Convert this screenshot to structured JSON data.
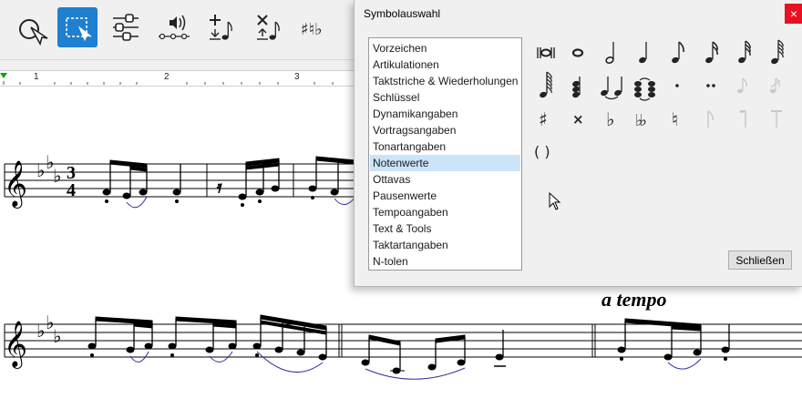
{
  "toolbar": {
    "buttons": [
      {
        "name": "select-tool",
        "icon": "pointer-circle-icon",
        "active": false
      },
      {
        "name": "rectangle-select-tool",
        "icon": "rectangle-select-icon",
        "active": true
      },
      {
        "name": "mixer-tool",
        "icon": "sliders-icon",
        "active": false
      },
      {
        "name": "playback-tool",
        "icon": "speaker-icon",
        "active": false
      },
      {
        "name": "insert-note-tool",
        "icon": "plus-note-icon",
        "active": false
      },
      {
        "name": "delete-note-tool",
        "icon": "cross-note-icon",
        "active": false
      },
      {
        "name": "accidentals-tool",
        "icon": "sharp-natural-flat-icon",
        "active": false
      }
    ],
    "accent_color": "#1f7fd1"
  },
  "ruler": {
    "numbers": [
      "1",
      "2",
      "3"
    ],
    "marker_color": "#00aa00"
  },
  "score": {
    "tempo_text": "a tempo"
  },
  "dialog": {
    "title": "Symbolauswahl",
    "close_glyph": "×",
    "categories": [
      "Vorzeichen",
      "Artikulationen",
      "Taktstriche & Wiederholungen",
      "Schlüssel",
      "Dynamikangaben",
      "Vortragsangaben",
      "Tonartangaben",
      "Notenwerte",
      "Ottavas",
      "Pausenwerte",
      "Tempoangaben",
      "Text & Tools",
      "Taktartangaben",
      "N-tolen"
    ],
    "selected_category": "Notenwerte",
    "symbols": [
      {
        "name": "double-whole-note-icon"
      },
      {
        "name": "whole-note-icon"
      },
      {
        "name": "half-note-icon"
      },
      {
        "name": "quarter-note-icon"
      },
      {
        "name": "eighth-note-icon"
      },
      {
        "name": "sixteenth-note-icon"
      },
      {
        "name": "thirty-second-note-icon"
      },
      {
        "name": "sixty-fourth-note-icon"
      },
      {
        "name": "hundred-twenty-eighth-note-icon"
      },
      {
        "name": "chord-icon"
      },
      {
        "name": "tie-icon"
      },
      {
        "name": "tied-chord-icon"
      },
      {
        "name": "dot-icon"
      },
      {
        "name": "double-dot-icon"
      },
      {
        "name": "grace-note-icon",
        "disabled": true
      },
      {
        "name": "grace-note-slashed-icon",
        "disabled": true
      },
      {
        "name": "sharp-icon",
        "glyph": "♯"
      },
      {
        "name": "double-sharp-icon",
        "glyph": "×"
      },
      {
        "name": "flat-icon",
        "glyph": "♭"
      },
      {
        "name": "double-flat-icon",
        "glyph": "♭♭"
      },
      {
        "name": "natural-icon",
        "glyph": "♮"
      },
      {
        "name": "flag-up-icon",
        "disabled": true
      },
      {
        "name": "flag-down-icon",
        "disabled": true
      },
      {
        "name": "flag-straight-icon",
        "disabled": true
      },
      {
        "name": "parentheses-icon",
        "glyph": "( )"
      }
    ],
    "close_button_label": "Schließen"
  }
}
